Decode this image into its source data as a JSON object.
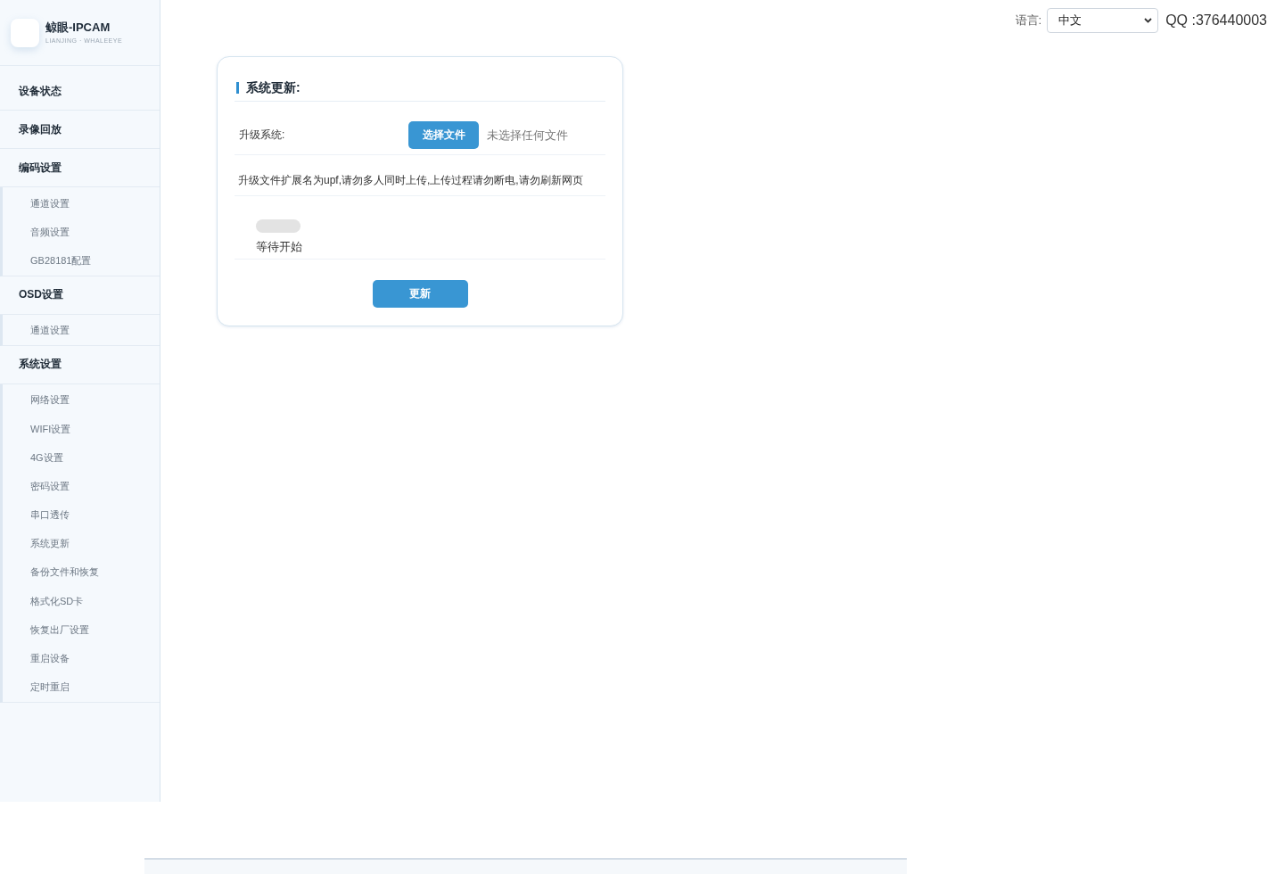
{
  "sidebar": {
    "brand": {
      "title": "鲸眼-IPCAM",
      "subtitle": "LIANJING · WHALEEYE"
    },
    "groups": [
      {
        "label": "设备状态"
      },
      {
        "label": "录像回放"
      },
      {
        "label": "编码设置",
        "children": [
          {
            "label": "通道设置"
          },
          {
            "label": "音频设置"
          },
          {
            "label": "GB28181配置"
          }
        ]
      },
      {
        "label": "OSD设置",
        "children": [
          {
            "label": "通道设置"
          }
        ]
      },
      {
        "label": "系统设置",
        "children": [
          {
            "label": "网络设置"
          },
          {
            "label": "WIFI设置"
          },
          {
            "label": "4G设置"
          },
          {
            "label": "密码设置"
          },
          {
            "label": "串口透传"
          },
          {
            "label": "系统更新"
          },
          {
            "label": "备份文件和恢复"
          },
          {
            "label": "格式化SD卡"
          },
          {
            "label": "恢复出厂设置"
          },
          {
            "label": "重启设备"
          },
          {
            "label": "定时重启"
          }
        ]
      }
    ]
  },
  "header": {
    "language_label": "语言:",
    "language_select": {
      "value": "中文"
    },
    "contact": "QQ :376440003"
  },
  "update_card": {
    "title": "系统更新:",
    "file_row": {
      "label": "升级系统:",
      "button": "选择文件",
      "status": "未选择任何文件"
    },
    "notice": "升级文件扩展名为upf,请勿多人同时上传,上传过程请勿断电,请勿刷新网页",
    "progress": {
      "level": 0,
      "status": "等待开始"
    },
    "submit_button": "更新"
  }
}
